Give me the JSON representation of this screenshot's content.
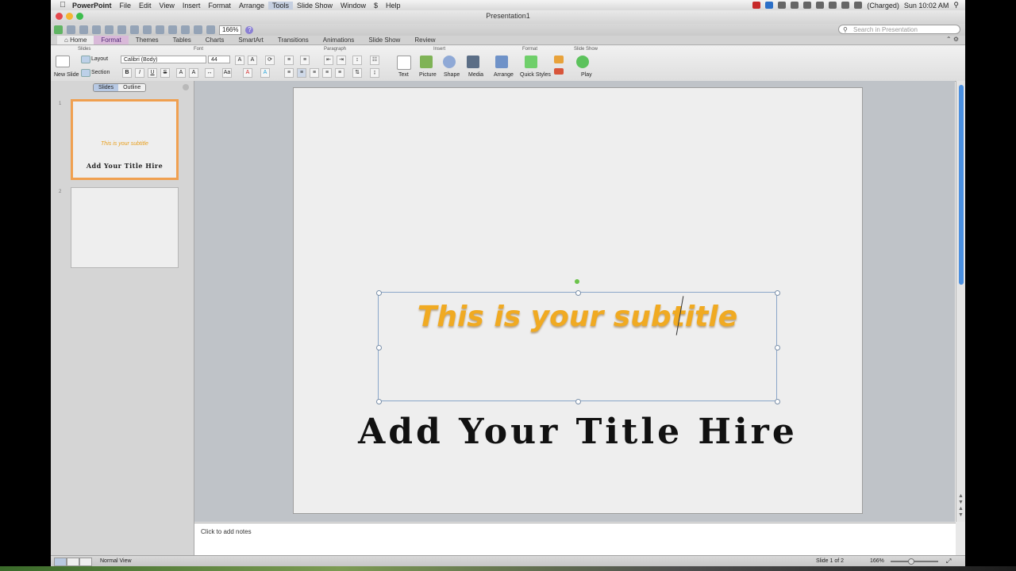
{
  "menubar": {
    "app_name": "PowerPoint",
    "items": [
      "File",
      "Edit",
      "View",
      "Insert",
      "Format",
      "Arrange",
      "Tools",
      "Slide Show",
      "Window",
      "$",
      "Help"
    ],
    "battery": "(Charged)",
    "clock": "Sun 10:02 AM"
  },
  "window": {
    "title": "Presentation1"
  },
  "toolbar": {
    "zoom": "166%",
    "search_placeholder": "Search in Presentation"
  },
  "tabs": [
    "Home",
    "Format",
    "Themes",
    "Tables",
    "Charts",
    "SmartArt",
    "Transitions",
    "Animations",
    "Slide Show",
    "Review"
  ],
  "ribbon": {
    "groups": {
      "slides": "Slides",
      "font": "Font",
      "paragraph": "Paragraph",
      "insert": "Insert",
      "format": "Format",
      "slideshow": "Slide Show"
    },
    "new_slide": "New Slide",
    "layout": "Layout",
    "section": "Section",
    "font_name": "Calibri (Body)",
    "font_size": "44",
    "insert_buttons": [
      "Text",
      "Picture",
      "Shape",
      "Media"
    ],
    "arrange": "Arrange",
    "quick_styles": "Quick Styles",
    "play": "Play"
  },
  "pane": {
    "tabs": [
      "Slides",
      "Outline"
    ],
    "thumbs": [
      {
        "num": "1",
        "subtitle": "This is your subtitle",
        "title": "Add Your Title Hire"
      },
      {
        "num": "2"
      }
    ]
  },
  "slide": {
    "subtitle": "This is your subtitle",
    "title": "Add Your Title Hire",
    "subtitle_color": "#f0aa22"
  },
  "notes": {
    "placeholder": "Click to add notes"
  },
  "status": {
    "view": "Normal View",
    "slide_count": "Slide 1 of 2",
    "zoom": "166%"
  }
}
